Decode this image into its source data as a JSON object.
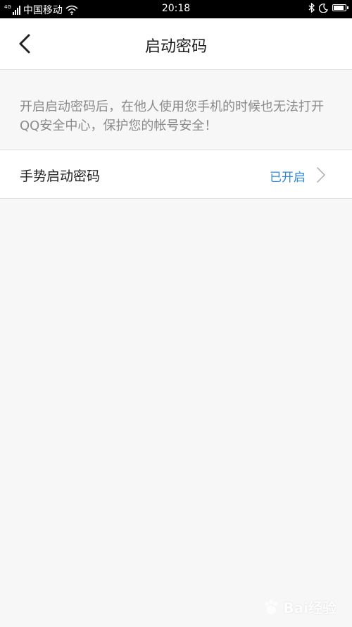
{
  "status_bar": {
    "signal_label": "4G",
    "carrier": "中国移动",
    "time": "20:18",
    "bluetooth_icon": "bluetooth-icon",
    "moon_icon": "moon-icon",
    "wifi_icon": "wifi-icon",
    "battery_level": 0.85
  },
  "nav": {
    "title": "启动密码",
    "back_icon": "chevron-left-icon"
  },
  "hint_text": "开启启动密码后，在他人使用您手机的时候也无法打开QQ安全中心，保护您的帐号安全！",
  "setting": {
    "label": "手势启动密码",
    "status": "已开启",
    "status_color": "#2c87e0",
    "chevron_icon": "chevron-right-icon"
  },
  "watermark": {
    "text": "Bai经验"
  }
}
